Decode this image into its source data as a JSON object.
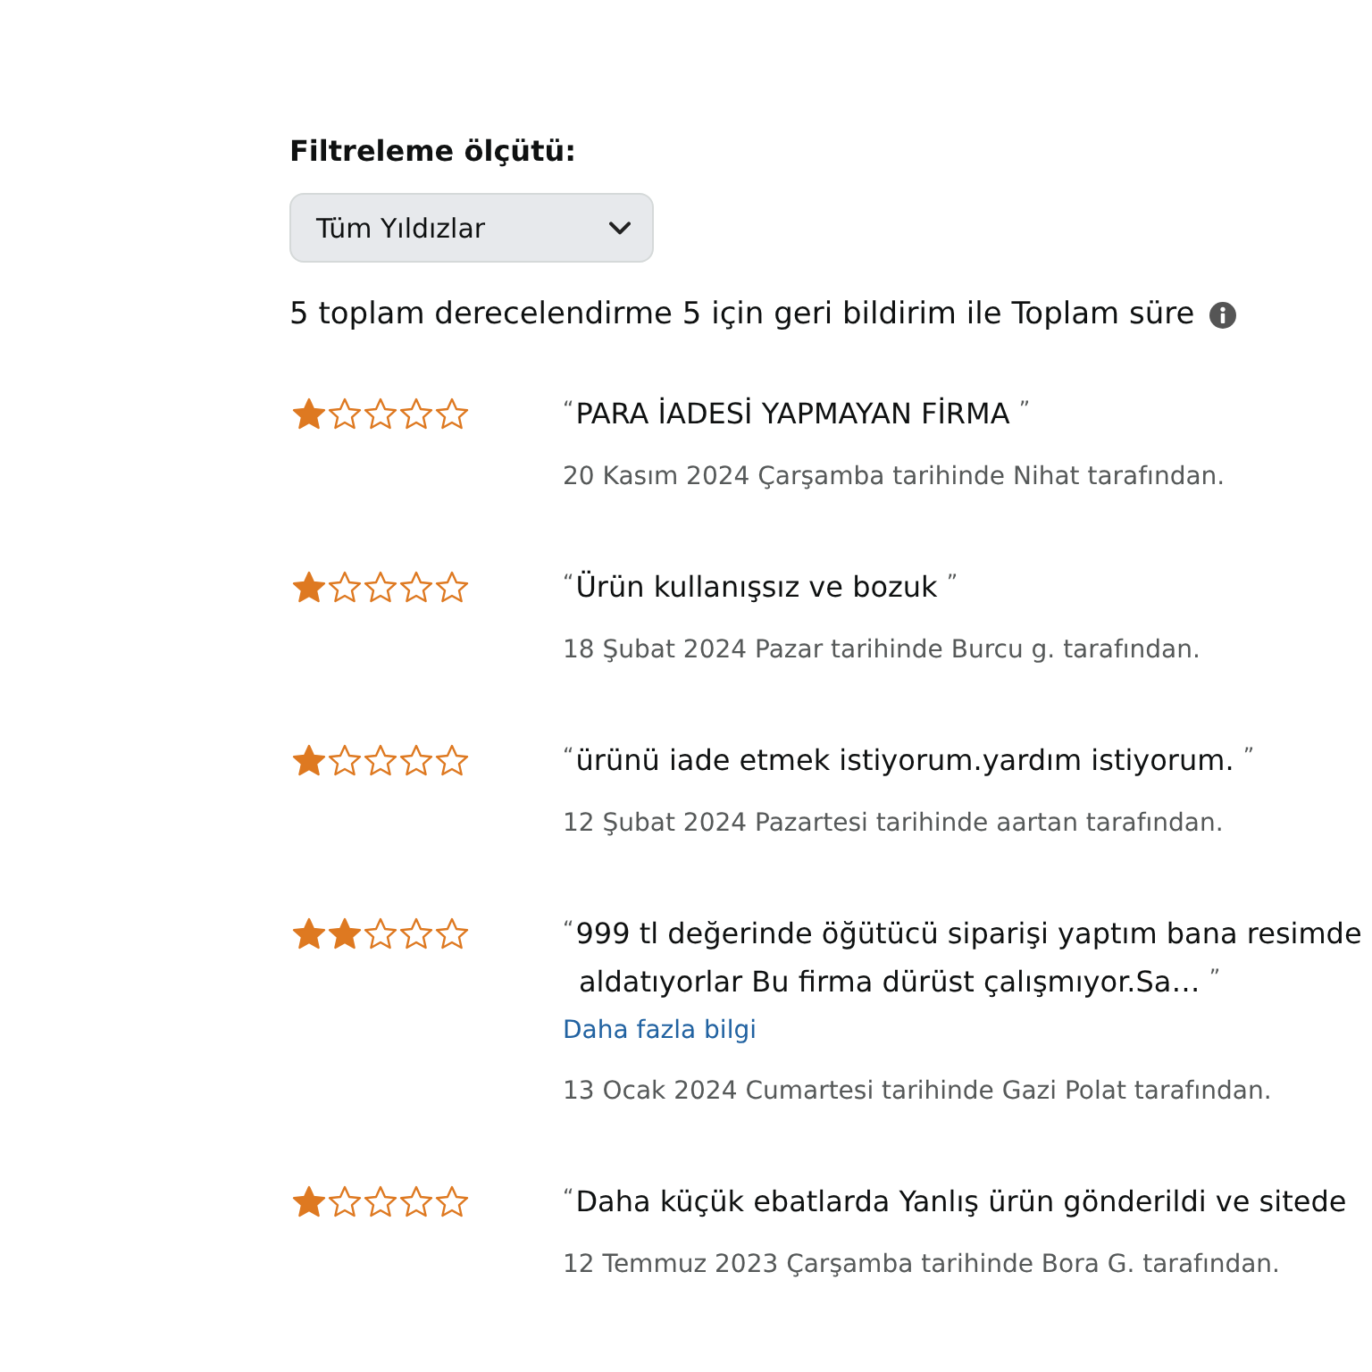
{
  "filter": {
    "label": "Filtreleme ölçütü:",
    "dropdown": {
      "value": "Tüm Yıldızlar"
    }
  },
  "summary": {
    "text": "5 toplam derecelendirme 5 için geri bildirim ile Toplam süre"
  },
  "reviews": [
    {
      "stars": 1,
      "title_lines": [
        "$^{“}$PARA İADESİ YAPMAYAN FİRMA $^{”}$"
      ],
      "byline": "20 Kasım 2024 Çarşamba tarihinde Nihat tarafından."
    },
    {
      "stars": 1,
      "title_lines": [
        "$^{“}$Ürün kullanışsız ve bozuk $^{”}$"
      ],
      "byline": "18 Şubat 2024 Pazar tarihinde Burcu g. tarafından."
    },
    {
      "stars": 1,
      "title_lines": [
        "$^{“}$ürünü iade etmek istiyorum.yardım istiyorum. $^{”}$"
      ],
      "byline": "12 Şubat 2024 Pazartesi tarihinde aartan tarafından."
    },
    {
      "stars": 2,
      "title_lines": [
        "$^{“}$999 tl değerinde öğütücü siparişi yaptım bana resimde",
        "aldatıyorlar Bu firma dürüst çalışmıyor.Sa… $^{”}$"
      ],
      "more_link": "Daha fazla bilgi",
      "byline": "13 Ocak 2024 Cumartesi tarihinde Gazi Polat tarafından."
    },
    {
      "stars": 1,
      "title_lines": [
        "$^{“}$Daha küçük ebatlarda Yanlış ürün gönderildi ve sitede"
      ],
      "byline": "12 Temmuz 2023 Çarşamba tarihinde Bora G. tarafından."
    }
  ]
}
